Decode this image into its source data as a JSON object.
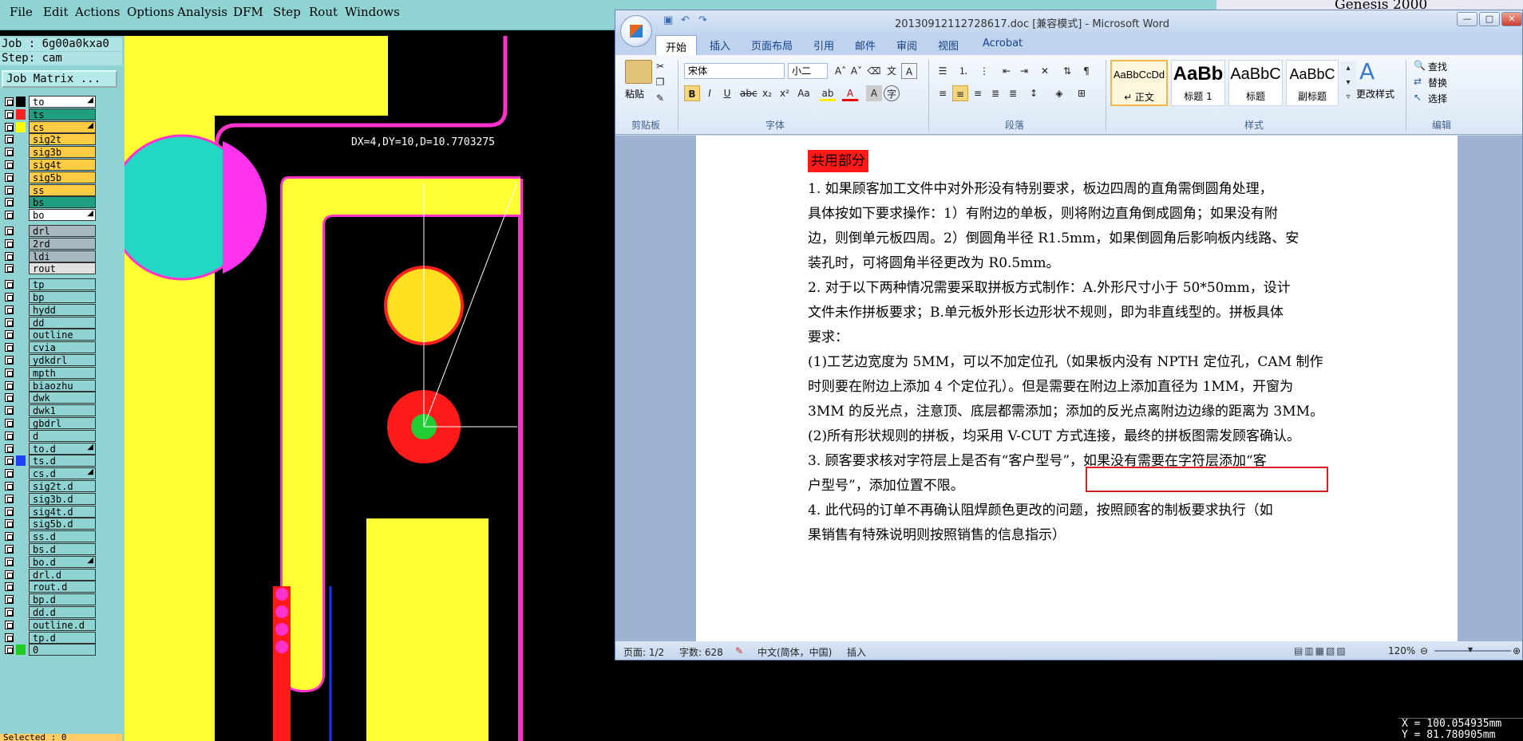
{
  "genesis": {
    "menu": [
      "File",
      "Edit",
      "Actions",
      "Options",
      "Analysis",
      "DFM",
      "Step",
      "Rout",
      "Windows"
    ],
    "brand_text": "Genesis 2000",
    "job_label": "Job : 6g00a0kxa0",
    "step_label": "Step: cam",
    "job_matrix_button": "Job Matrix ...",
    "layers": [
      {
        "name": "to",
        "color": "#ffffff",
        "swatch": "#000000",
        "arrow": true
      },
      {
        "name": "ts",
        "color": "#1f9f7f",
        "swatch": "#ff2020",
        "arrow": false
      },
      {
        "name": "cs",
        "color": "#ffcc44",
        "swatch": "#ffff00",
        "arrow": true
      },
      {
        "name": "sig2t",
        "color": "#ffcc44",
        "swatch": "",
        "arrow": false
      },
      {
        "name": "sig3b",
        "color": "#ffcc44",
        "swatch": "",
        "arrow": false
      },
      {
        "name": "sig4t",
        "color": "#ffcc44",
        "swatch": "",
        "arrow": false
      },
      {
        "name": "sig5b",
        "color": "#ffcc44",
        "swatch": "",
        "arrow": false
      },
      {
        "name": "ss",
        "color": "#ffcc44",
        "swatch": "",
        "arrow": false
      },
      {
        "name": "bs",
        "color": "#1f9f7f",
        "swatch": "",
        "arrow": false
      },
      {
        "name": "bo",
        "color": "#ffffff",
        "swatch": "",
        "arrow": true
      },
      {
        "name": "drl",
        "color": "#a8b8c0",
        "swatch": "",
        "arrow": false
      },
      {
        "name": "2rd",
        "color": "#a8b8c0",
        "swatch": "",
        "arrow": false
      },
      {
        "name": "ldi",
        "color": "#a8b8c0",
        "swatch": "",
        "arrow": false
      },
      {
        "name": "rout",
        "color": "#e0e0e0",
        "swatch": "",
        "arrow": false
      },
      {
        "name": "tp",
        "color": "#8fd3d3",
        "swatch": "",
        "arrow": false
      },
      {
        "name": "bp",
        "color": "#8fd3d3",
        "swatch": "",
        "arrow": false
      },
      {
        "name": "hydd",
        "color": "#8fd3d3",
        "swatch": "",
        "arrow": false
      },
      {
        "name": "dd",
        "color": "#8fd3d3",
        "swatch": "",
        "arrow": false
      },
      {
        "name": "outline",
        "color": "#8fd3d3",
        "swatch": "",
        "arrow": false
      },
      {
        "name": "cvia",
        "color": "#8fd3d3",
        "swatch": "",
        "arrow": false
      },
      {
        "name": "ydkdrl",
        "color": "#8fd3d3",
        "swatch": "",
        "arrow": false
      },
      {
        "name": "mpth",
        "color": "#8fd3d3",
        "swatch": "",
        "arrow": false
      },
      {
        "name": "biaozhu",
        "color": "#8fd3d3",
        "swatch": "",
        "arrow": false
      },
      {
        "name": "dwk",
        "color": "#8fd3d3",
        "swatch": "",
        "arrow": false
      },
      {
        "name": "dwk1",
        "color": "#8fd3d3",
        "swatch": "",
        "arrow": false
      },
      {
        "name": "gbdrl",
        "color": "#8fd3d3",
        "swatch": "",
        "arrow": false
      },
      {
        "name": "d",
        "color": "#8fd3d3",
        "swatch": "",
        "arrow": false
      },
      {
        "name": "to.d",
        "color": "#8fd3d3",
        "swatch": "",
        "arrow": true
      },
      {
        "name": "ts.d",
        "color": "#8fd3d3",
        "swatch": "#2040ff",
        "arrow": false
      },
      {
        "name": "cs.d",
        "color": "#8fd3d3",
        "swatch": "",
        "arrow": true
      },
      {
        "name": "sig2t.d",
        "color": "#8fd3d3",
        "swatch": "",
        "arrow": false
      },
      {
        "name": "sig3b.d",
        "color": "#8fd3d3",
        "swatch": "",
        "arrow": false
      },
      {
        "name": "sig4t.d",
        "color": "#8fd3d3",
        "swatch": "",
        "arrow": false
      },
      {
        "name": "sig5b.d",
        "color": "#8fd3d3",
        "swatch": "",
        "arrow": false
      },
      {
        "name": "ss.d",
        "color": "#8fd3d3",
        "swatch": "",
        "arrow": false
      },
      {
        "name": "bs.d",
        "color": "#8fd3d3",
        "swatch": "",
        "arrow": false
      },
      {
        "name": "bo.d",
        "color": "#8fd3d3",
        "swatch": "",
        "arrow": true
      },
      {
        "name": "drl.d",
        "color": "#8fd3d3",
        "swatch": "",
        "arrow": false
      },
      {
        "name": "rout.d",
        "color": "#8fd3d3",
        "swatch": "",
        "arrow": false
      },
      {
        "name": "bp.d",
        "color": "#8fd3d3",
        "swatch": "",
        "arrow": false
      },
      {
        "name": "dd.d",
        "color": "#8fd3d3",
        "swatch": "",
        "arrow": false
      },
      {
        "name": "outline.d",
        "color": "#8fd3d3",
        "swatch": "",
        "arrow": false
      },
      {
        "name": "tp.d",
        "color": "#8fd3d3",
        "swatch": "",
        "arrow": false
      },
      {
        "name": "0",
        "color": "#8fd3d3",
        "swatch": "#20cc20",
        "arrow": false
      }
    ],
    "selected_label": "Selected : 0",
    "measure_text": "DX=4,DY=10,D=10.7703275",
    "coord_x": "X = 100.054935mm",
    "coord_y": "Y = 81.780905mm"
  },
  "word": {
    "title": "20130912112728617.doc [兼容模式] - Microsoft Word",
    "tabs": [
      "开始",
      "插入",
      "页面布局",
      "引用",
      "邮件",
      "审阅",
      "视图",
      "Acrobat"
    ],
    "clipboard_group": "剪贴板",
    "paste_label": "粘贴",
    "font_group": "字体",
    "font_name": "宋体",
    "font_size": "小二",
    "paragraph_group": "段落",
    "styles_group": "样式",
    "styles": [
      {
        "preview": "AaBbCcDd",
        "label": "↵ 正文"
      },
      {
        "preview": "AaBb",
        "label": "标题 1"
      },
      {
        "preview": "AaBbC",
        "label": "标题"
      },
      {
        "preview": "AaBbC",
        "label": "副标题"
      }
    ],
    "change_styles": "更改样式",
    "editing_group": "编辑",
    "find_label": "查找",
    "replace_label": "替换",
    "select_label": "选择",
    "doc": {
      "heading": "共用部分",
      "lines": [
        "1.  如果顾客加工文件中对外形没有特别要求，板边四周的直角需倒圆角处理，",
        "具体按如下要求操作：1）有附边的单板，则将附边直角倒成圆角；如果没有附",
        "边，则倒单元板四周。2）倒圆角半径 R1.5mm，如果倒圆角后影响板内线路、安",
        "装孔时，可将圆角半径更改为 R0.5mm。",
        "2.  对于以下两种情况需要采取拼板方式制作：A.外形尺寸小于 50*50mm，设计",
        "文件未作拼板要求；B.单元板外形长边形状不规则，即为非直线型的。拼板具体",
        "要求：",
        "(1)工艺边宽度为 5MM，可以不加定位孔（如果板内没有 NPTH 定位孔，CAM 制作",
        "时则要在附边上添加 4 个定位孔）。但是需要在附边上添加直径为 1MM，开窗为",
        "3MM 的反光点，注意顶、底层都需添加；添加的反光点离附边边缘的距离为 3MM。",
        "(2)所有形状规则的拼板，均采用 V-CUT 方式连接，最终的拼板图需发顾客确认。",
        "3.  顾客要求核对字符层上是否有“客户型号”，如果没有需要在字符层添加“客",
        "户型号”，添加位置不限。",
        "4.  此代码的订单不再确认阻焊颜色更改的问题，按照顾客的制板要求执行（如",
        "果销售有特殊说明则按照销售的信息指示）"
      ]
    },
    "status": {
      "page": "页面: 1/2",
      "words": "字数: 628",
      "language": "中文(简体，中国)",
      "mode": "插入",
      "zoom": "120%"
    }
  }
}
